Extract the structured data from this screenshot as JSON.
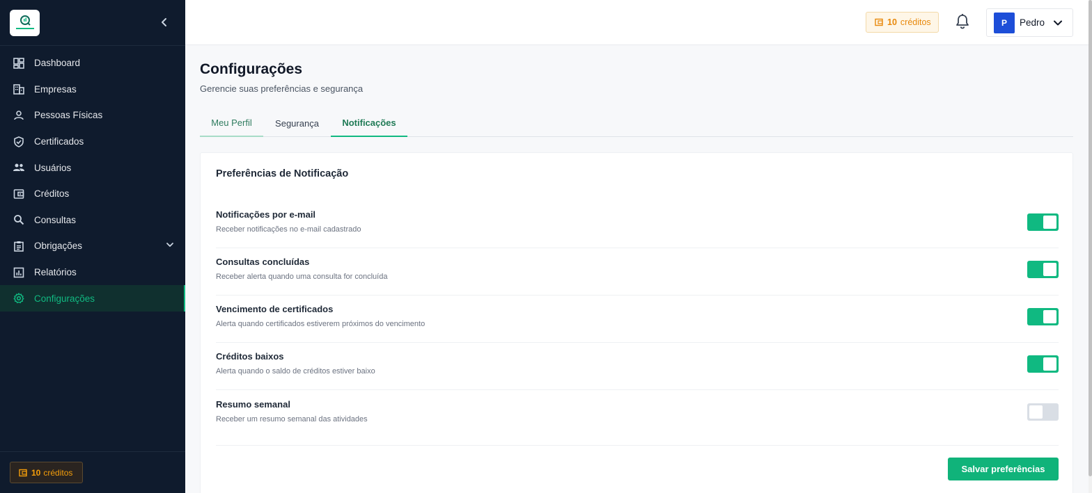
{
  "sidebar": {
    "logo_icon": "company-logo",
    "items": [
      {
        "label": "Dashboard",
        "icon": "dashboard-icon"
      },
      {
        "label": "Empresas",
        "icon": "building-icon"
      },
      {
        "label": "Pessoas Físicas",
        "icon": "person-icon"
      },
      {
        "label": "Certificados",
        "icon": "shield-check-icon"
      },
      {
        "label": "Usuários",
        "icon": "users-icon"
      },
      {
        "label": "Créditos",
        "icon": "wallet-icon"
      },
      {
        "label": "Consultas",
        "icon": "search-icon"
      },
      {
        "label": "Obrigações",
        "icon": "clipboard-icon"
      },
      {
        "label": "Relatórios",
        "icon": "chart-icon"
      },
      {
        "label": "Configurações",
        "icon": "gear-icon"
      }
    ],
    "credits": {
      "amount": "10",
      "label": "créditos"
    }
  },
  "header": {
    "credits": {
      "amount": "10",
      "label": "créditos"
    },
    "user": {
      "initial": "P",
      "name": "Pedro"
    }
  },
  "page": {
    "title": "Configurações",
    "subtitle": "Gerencie suas preferências e segurança"
  },
  "tabs": [
    {
      "label": "Meu Perfil"
    },
    {
      "label": "Segurança"
    },
    {
      "label": "Notificações"
    }
  ],
  "card": {
    "title": "Preferências de Notificação",
    "rows": [
      {
        "title": "Notificações por e-mail",
        "desc": "Receber notificações no e-mail cadastrado",
        "enabled": true
      },
      {
        "title": "Consultas concluídas",
        "desc": "Receber alerta quando uma consulta for concluída",
        "enabled": true
      },
      {
        "title": "Vencimento de certificados",
        "desc": "Alerta quando certificados estiverem próximos do vencimento",
        "enabled": true
      },
      {
        "title": "Créditos baixos",
        "desc": "Alerta quando o saldo de créditos estiver baixo",
        "enabled": true
      },
      {
        "title": "Resumo semanal",
        "desc": "Receber um resumo semanal das atividades",
        "enabled": false
      }
    ],
    "save_label": "Salvar preferências"
  },
  "colors": {
    "sidebar_bg": "#0f1b2d",
    "accent": "#10b981",
    "credit_orange": "#e8890c",
    "avatar_blue": "#1d4ed8"
  }
}
